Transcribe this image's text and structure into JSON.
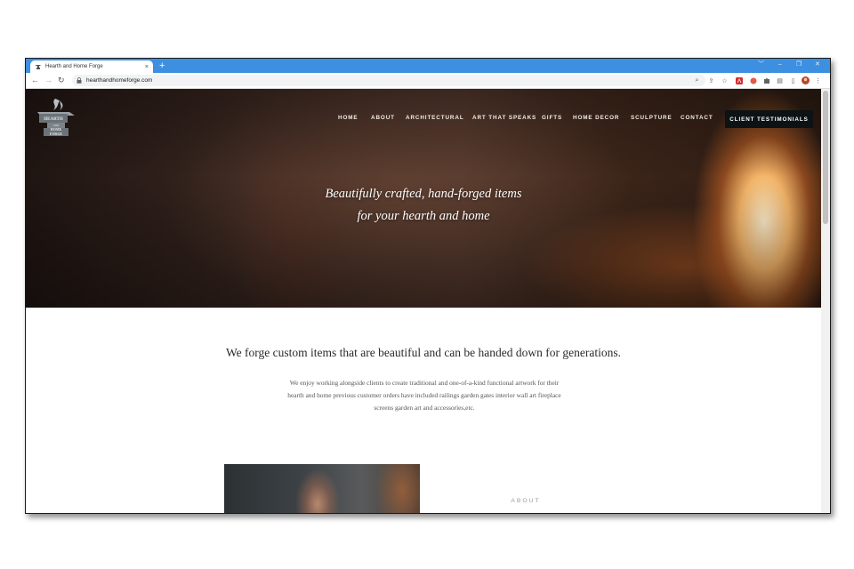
{
  "browser": {
    "tab_title": "Hearth and Home Forge",
    "tab_close": "×",
    "new_tab": "+",
    "url": "hearthandhomeforge.com",
    "window_controls": [
      "﹀",
      "–",
      "❐",
      "✕"
    ]
  },
  "site": {
    "logo_text": [
      "HEARTH",
      "AND",
      "HOME",
      "FORGE"
    ],
    "nav": [
      "HOME",
      "ABOUT",
      "ARCHITECTURAL",
      "ART THAT SPEAKS",
      "GIFTS",
      "HOME DECOR",
      "SCULPTURE",
      "CONTACT"
    ],
    "cta": "CLIENT TESTIMONIALS",
    "tagline_line1": "Beautifully crafted, hand-forged items",
    "tagline_line2": "for your hearth and home",
    "intro_heading": "We forge custom items that are beautiful and can be handed down for generations.",
    "intro_body": "We enjoy working  alongside clients to create traditional and one-of-a-kind functional artwork for their hearth and home previous customer orders have included railings garden gates interior wall art fireplace screens garden art and accessories,etc.",
    "about_label": "ABOUT"
  },
  "colors": {
    "browser_accent": "#3d8fe0",
    "cta_background": "#0d1214",
    "nav_text": "#f2ece6"
  }
}
